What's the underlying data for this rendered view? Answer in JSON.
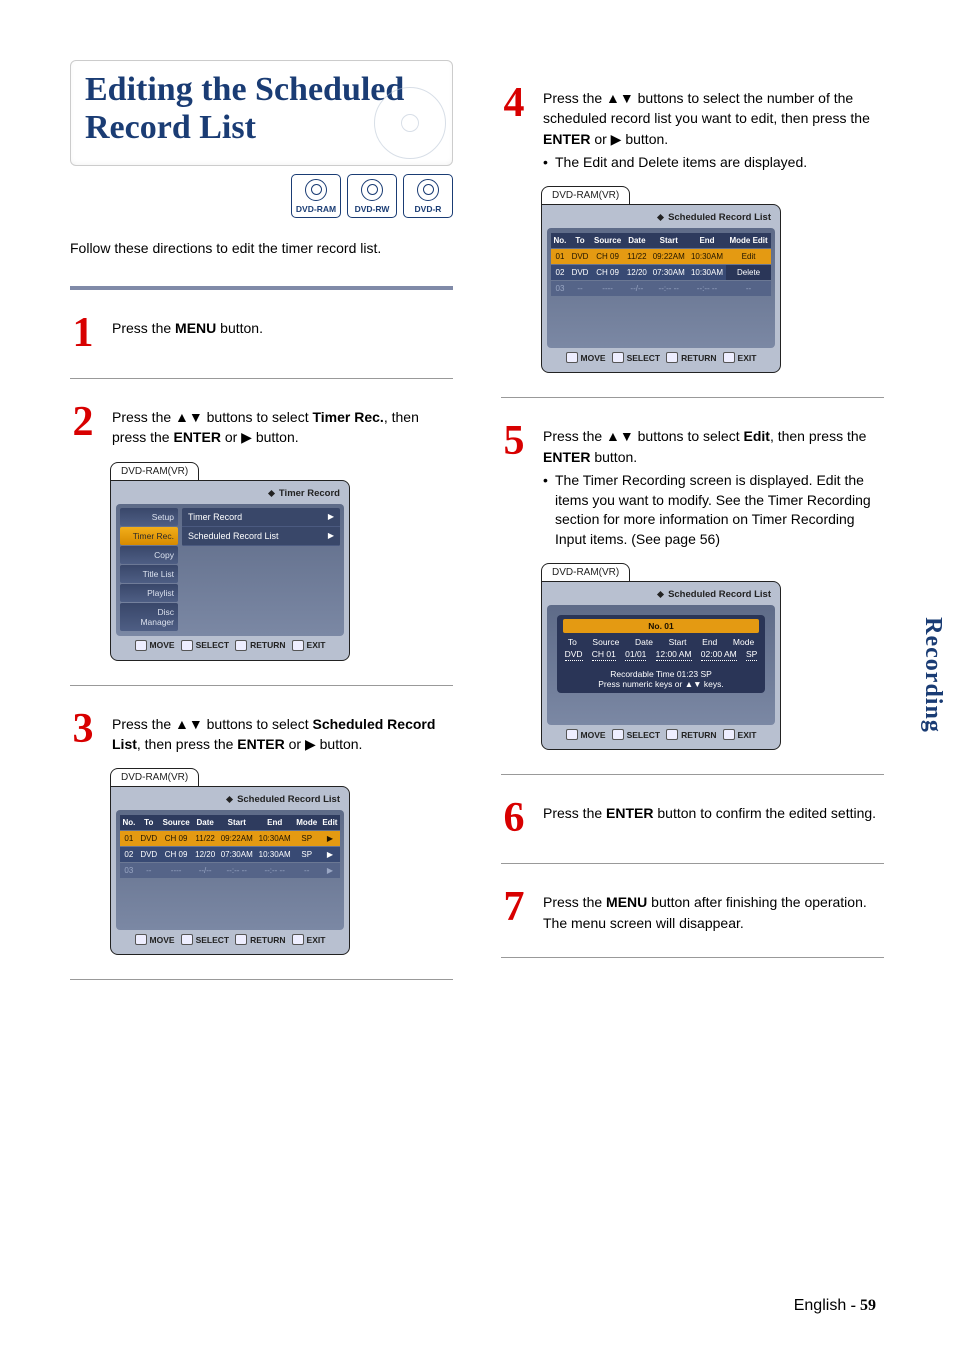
{
  "title": "Editing the Scheduled Record List",
  "formats": [
    "DVD-RAM",
    "DVD-RW",
    "DVD-R"
  ],
  "intro": "Follow these directions to edit the timer record list.",
  "sectionTab": "Recording",
  "footer": {
    "lang": "English",
    "dash": " - ",
    "page": "59"
  },
  "osdTab": "DVD-RAM(VR)",
  "osdTitleTimer": "Timer Record",
  "osdTitleSched": "Scheduled Record List",
  "footnav": {
    "move": "MOVE",
    "select": "SELECT",
    "return": "RETURN",
    "exit": "EXIT"
  },
  "sidemenu": [
    {
      "t": "Setup"
    },
    {
      "t": "Timer Rec.",
      "sel": true
    },
    {
      "t": "Copy"
    },
    {
      "t": "Title List"
    },
    {
      "t": "Playlist"
    },
    {
      "t": "Disc Manager"
    }
  ],
  "timerOptions": [
    {
      "t": "Timer Record"
    },
    {
      "t": "Scheduled Record List"
    }
  ],
  "schedHeaders": [
    "No.",
    "To",
    "Source",
    "Date",
    "Start",
    "End",
    "Mode",
    "Edit"
  ],
  "schedRowsStep3": [
    [
      "01",
      "DVD",
      "CH 09",
      "11/22",
      "09:22AM",
      "10:30AM",
      "SP",
      "▶"
    ],
    [
      "02",
      "DVD",
      "CH 09",
      "12/20",
      "07:30AM",
      "10:30AM",
      "SP",
      "▶"
    ],
    [
      "03",
      "--",
      "----",
      "--/--",
      "--:-- --",
      "--:-- --",
      "--",
      "▶"
    ]
  ],
  "schedHeaders4": [
    "No.",
    "To",
    "Source",
    "Date",
    "Start",
    "End",
    "Mode Edit"
  ],
  "schedRowsStep4": [
    [
      "01",
      "DVD",
      "CH 09",
      "11/22",
      "09:22AM",
      "10:30AM",
      "Edit"
    ],
    [
      "02",
      "DVD",
      "CH 09",
      "12/20",
      "07:30AM",
      "10:30AM",
      "Delete"
    ],
    [
      "03",
      "--",
      "----",
      "--/--",
      "--:-- --",
      "--:-- --",
      "--"
    ]
  ],
  "editor": {
    "header": "No. 01",
    "cols": [
      "To",
      "Source",
      "Date",
      "Start",
      "End",
      "Mode"
    ],
    "vals": [
      "DVD",
      "CH 01",
      "01/01",
      "12:00 AM",
      "02:00 AM",
      "SP"
    ],
    "l1": "Recordable Time 01:23 SP",
    "l2": "Press numeric keys or ▲▼ keys."
  },
  "steps": {
    "1": {
      "pre": "Press the ",
      "b1": "MENU",
      "post": " button."
    },
    "2": {
      "t1": "Press the ▲▼ buttons to select ",
      "b1": "Timer Rec.",
      "t2": ", then press the ",
      "b2": "ENTER",
      "t3": " or ▶ button."
    },
    "3": {
      "t1": "Press the ▲▼ buttons to select ",
      "b1": "Scheduled Record List",
      "t2": ", then press the ",
      "b2": "ENTER",
      "t3": " or ▶ button."
    },
    "4": {
      "t1": "Press the ▲▼ buttons to select the number of the scheduled record list you want to edit, then press the ",
      "b1": "ENTER",
      "t2": " or ▶ button.",
      "bul": "The Edit and Delete items are displayed."
    },
    "5": {
      "t1": "Press the ▲▼ buttons to select ",
      "b1": "Edit",
      "t2": ", then press the ",
      "b2": "ENTER",
      "t3": " button.",
      "bul": "The Timer Recording screen is displayed. Edit the items you want to modify. See the Timer Recording section for more information on Timer Recording Input items. (See page 56)"
    },
    "6": {
      "t1": "Press the ",
      "b1": "ENTER",
      "t2": " button to confirm the edited setting."
    },
    "7": {
      "t1": "Press the ",
      "b1": "MENU",
      "t2": " button after finishing the operation. The menu screen will disappear."
    }
  }
}
